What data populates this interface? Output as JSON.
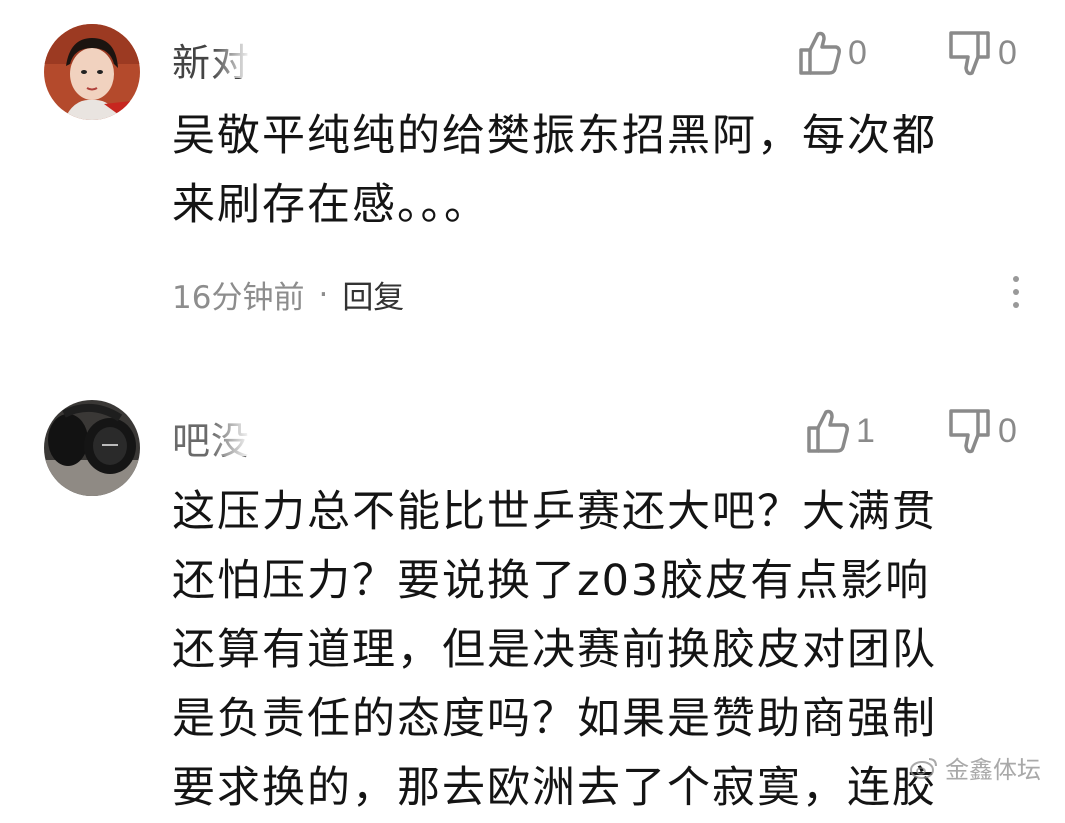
{
  "comments": [
    {
      "username": "新对",
      "likes": "0",
      "dislikes": "0",
      "text_lines": [
        "吴敬平纯纯的给樊振东招黑阿，每次都",
        "来刷存在感。。。"
      ],
      "time": "16分钟前",
      "separator": "·",
      "reply_label": "回复"
    },
    {
      "username": "吧没",
      "likes": "1",
      "dislikes": "0",
      "text_lines": [
        "这压力总不能比世乒赛还大吧？大满贯",
        "还怕压力？要说换了z03胶皮有点影响",
        "还算有道理，但是决赛前换胶皮对团队",
        "是负责任的态度吗？如果是赞助商强制",
        "要求换的，那去欧洲去了个寂寞，连胶"
      ]
    }
  ],
  "watermark": {
    "text": "金鑫体坛",
    "icon": "weibo-icon"
  },
  "icons": {
    "like": "thumbs-up-icon",
    "dislike": "thumbs-down-icon",
    "more": "more-vertical-icon"
  },
  "colors": {
    "text": "#141414",
    "muted": "#8d8d8d",
    "icon": "#8a8a8a"
  }
}
